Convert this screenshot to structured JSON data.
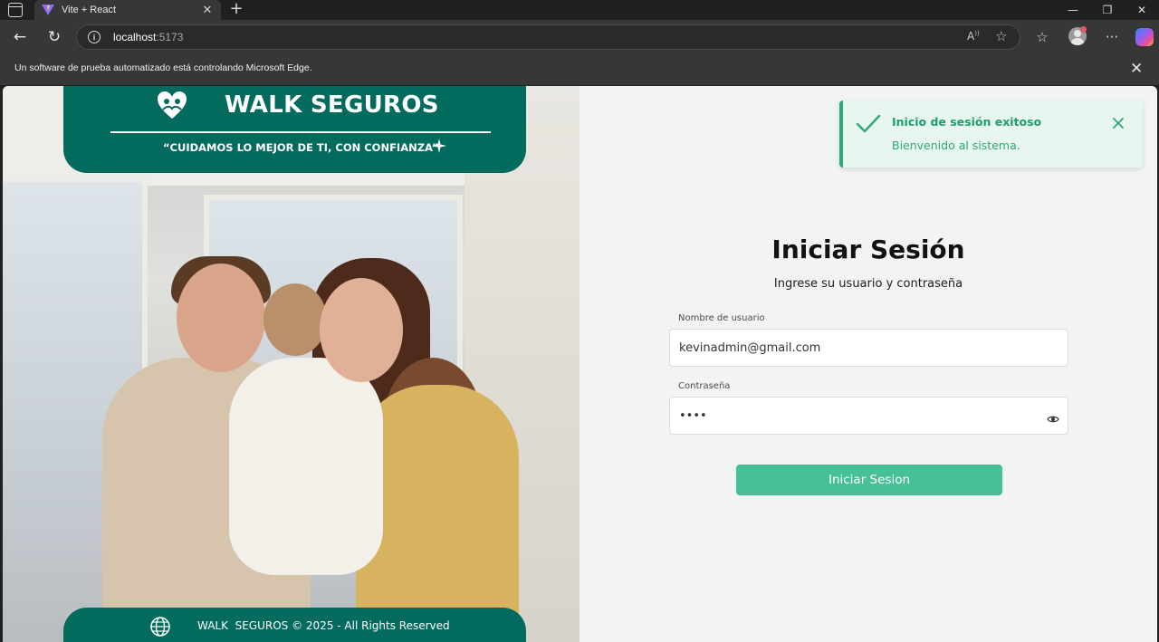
{
  "browser": {
    "tab_title": "Vite + React",
    "url_host": "localhost",
    "url_port": ":5173",
    "infobar_text": "Un software de prueba automatizado está controlando Microsoft Edge.",
    "icons": [
      "sidebar-toggle-icon",
      "vite-favicon",
      "close-icon",
      "plus-icon",
      "minimize-icon",
      "restore-icon",
      "back-arrow-icon",
      "refresh-icon",
      "info-icon",
      "read-aloud-icon",
      "star-icon",
      "favorites-icon",
      "profile-avatar",
      "more-icon",
      "copilot-icon"
    ]
  },
  "hero": {
    "brand_name": "WALK SEGUROS",
    "slogan": "“CUIDAMOS LO MEJOR DE TI, CON CONFIANZA”",
    "footer_text": "WALK  SEGUROS © 2025 - All Rights Reserved",
    "brand_color": "#036b5e"
  },
  "login": {
    "title": "Iniciar Sesión",
    "subtitle": "Ingrese su usuario y contraseña",
    "username_label": "Nombre de usuario",
    "username_value": "kevinadmin@gmail.com",
    "password_label": "Contraseña",
    "password_value": "1234",
    "submit_label": "Iniciar Sesion",
    "button_color": "#47bf97"
  },
  "toast": {
    "title": "Inicio de sesión exitoso",
    "message": "Bienvenido al sistema.",
    "accent_color": "#2ea879"
  }
}
